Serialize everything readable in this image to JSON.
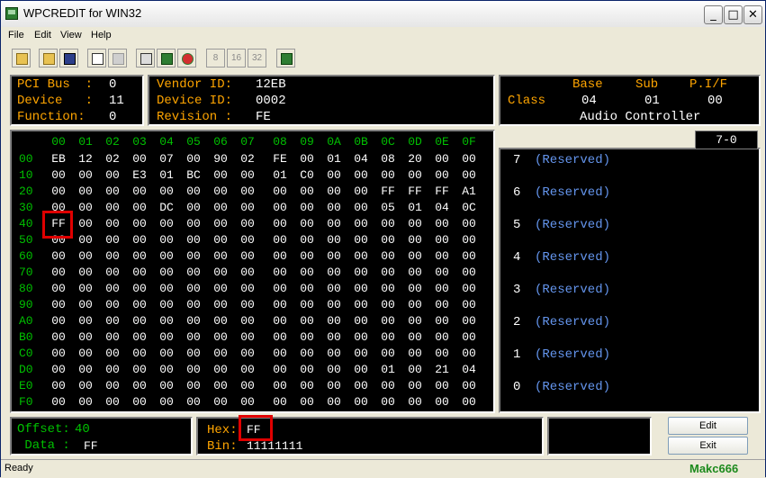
{
  "window": {
    "title": "WPCREDIT for WIN32"
  },
  "menu": [
    "File",
    "Edit",
    "View",
    "Help"
  ],
  "toolbar": {
    "bitmode": [
      "8",
      "16",
      "32"
    ]
  },
  "pci": {
    "bus_label": "PCI Bus  :",
    "bus": "0",
    "device_label": "Device   :",
    "device": "11",
    "function_label": "Function:",
    "function": "0"
  },
  "vendor": {
    "vendor_label": "Vendor ID:",
    "vendor_id": "12EB",
    "device_label": "Device ID:",
    "device_id": "0002",
    "revision_label": "Revision :",
    "revision": "FE"
  },
  "classinfo": {
    "class_label": "Class",
    "base_label": "Base",
    "sub_label": "Sub",
    "pif_label": "P.I/F",
    "base": "04",
    "sub": "01",
    "pif": "00",
    "name": "Audio Controller"
  },
  "hex": {
    "columns": [
      "00",
      "01",
      "02",
      "03",
      "04",
      "05",
      "06",
      "07",
      "08",
      "09",
      "0A",
      "0B",
      "0C",
      "0D",
      "0E",
      "0F"
    ],
    "rows": [
      {
        "addr": "00",
        "cells": [
          "EB",
          "12",
          "02",
          "00",
          "07",
          "00",
          "90",
          "02",
          "FE",
          "00",
          "01",
          "04",
          "08",
          "20",
          "00",
          "00"
        ]
      },
      {
        "addr": "10",
        "cells": [
          "00",
          "00",
          "00",
          "E3",
          "01",
          "BC",
          "00",
          "00",
          "01",
          "C0",
          "00",
          "00",
          "00",
          "00",
          "00",
          "00"
        ]
      },
      {
        "addr": "20",
        "cells": [
          "00",
          "00",
          "00",
          "00",
          "00",
          "00",
          "00",
          "00",
          "00",
          "00",
          "00",
          "00",
          "FF",
          "FF",
          "FF",
          "A1"
        ]
      },
      {
        "addr": "30",
        "cells": [
          "00",
          "00",
          "00",
          "00",
          "DC",
          "00",
          "00",
          "00",
          "00",
          "00",
          "00",
          "00",
          "05",
          "01",
          "04",
          "0C"
        ]
      },
      {
        "addr": "40",
        "cells": [
          "FF",
          "00",
          "00",
          "00",
          "00",
          "00",
          "00",
          "00",
          "00",
          "00",
          "00",
          "00",
          "00",
          "00",
          "00",
          "00"
        ]
      },
      {
        "addr": "50",
        "cells": [
          "00",
          "00",
          "00",
          "00",
          "00",
          "00",
          "00",
          "00",
          "00",
          "00",
          "00",
          "00",
          "00",
          "00",
          "00",
          "00"
        ]
      },
      {
        "addr": "60",
        "cells": [
          "00",
          "00",
          "00",
          "00",
          "00",
          "00",
          "00",
          "00",
          "00",
          "00",
          "00",
          "00",
          "00",
          "00",
          "00",
          "00"
        ]
      },
      {
        "addr": "70",
        "cells": [
          "00",
          "00",
          "00",
          "00",
          "00",
          "00",
          "00",
          "00",
          "00",
          "00",
          "00",
          "00",
          "00",
          "00",
          "00",
          "00"
        ]
      },
      {
        "addr": "80",
        "cells": [
          "00",
          "00",
          "00",
          "00",
          "00",
          "00",
          "00",
          "00",
          "00",
          "00",
          "00",
          "00",
          "00",
          "00",
          "00",
          "00"
        ]
      },
      {
        "addr": "90",
        "cells": [
          "00",
          "00",
          "00",
          "00",
          "00",
          "00",
          "00",
          "00",
          "00",
          "00",
          "00",
          "00",
          "00",
          "00",
          "00",
          "00"
        ]
      },
      {
        "addr": "A0",
        "cells": [
          "00",
          "00",
          "00",
          "00",
          "00",
          "00",
          "00",
          "00",
          "00",
          "00",
          "00",
          "00",
          "00",
          "00",
          "00",
          "00"
        ]
      },
      {
        "addr": "B0",
        "cells": [
          "00",
          "00",
          "00",
          "00",
          "00",
          "00",
          "00",
          "00",
          "00",
          "00",
          "00",
          "00",
          "00",
          "00",
          "00",
          "00"
        ]
      },
      {
        "addr": "C0",
        "cells": [
          "00",
          "00",
          "00",
          "00",
          "00",
          "00",
          "00",
          "00",
          "00",
          "00",
          "00",
          "00",
          "00",
          "00",
          "00",
          "00"
        ]
      },
      {
        "addr": "D0",
        "cells": [
          "00",
          "00",
          "00",
          "00",
          "00",
          "00",
          "00",
          "00",
          "00",
          "00",
          "00",
          "00",
          "01",
          "00",
          "21",
          "04"
        ]
      },
      {
        "addr": "E0",
        "cells": [
          "00",
          "00",
          "00",
          "00",
          "00",
          "00",
          "00",
          "00",
          "00",
          "00",
          "00",
          "00",
          "00",
          "00",
          "00",
          "00"
        ]
      },
      {
        "addr": "F0",
        "cells": [
          "00",
          "00",
          "00",
          "00",
          "00",
          "00",
          "00",
          "00",
          "00",
          "00",
          "00",
          "00",
          "00",
          "00",
          "00",
          "00"
        ]
      }
    ]
  },
  "bits": {
    "tab": "7-0",
    "items": [
      {
        "num": "7",
        "desc": "(Reserved)"
      },
      {
        "num": "6",
        "desc": "(Reserved)"
      },
      {
        "num": "5",
        "desc": "(Reserved)"
      },
      {
        "num": "4",
        "desc": "(Reserved)"
      },
      {
        "num": "3",
        "desc": "(Reserved)"
      },
      {
        "num": "2",
        "desc": "(Reserved)"
      },
      {
        "num": "1",
        "desc": "(Reserved)"
      },
      {
        "num": "0",
        "desc": "(Reserved)"
      }
    ]
  },
  "bottom": {
    "offset_label": "Offset:",
    "offset": "40",
    "data_label": " Data :",
    "data": "FF",
    "hex_label": "Hex:",
    "hex": "FF",
    "bin_label": "Bin:",
    "bin": "11111111"
  },
  "buttons": {
    "edit": "Edit",
    "exit": "Exit"
  },
  "status": {
    "text": "Ready",
    "author": "Makc666"
  },
  "colors": {
    "label": "#ffa500",
    "address": "#00c000",
    "bitdesc": "#6495ed",
    "highlight": "#e00000"
  }
}
